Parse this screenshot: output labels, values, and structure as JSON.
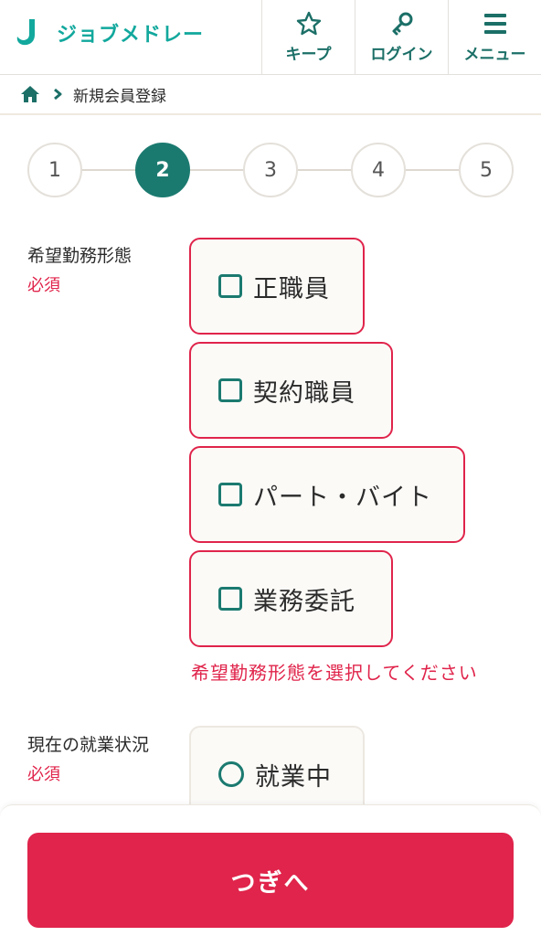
{
  "header": {
    "logo_text": "ジョブメドレー",
    "nav": [
      {
        "label": "キープ",
        "icon": "star-icon"
      },
      {
        "label": "ログイン",
        "icon": "key-icon"
      },
      {
        "label": "メニュー",
        "icon": "hamburger-icon"
      }
    ]
  },
  "breadcrumb": {
    "home_icon": "home-icon",
    "current": "新規会員登録"
  },
  "stepper": {
    "steps": [
      "1",
      "2",
      "3",
      "4",
      "5"
    ],
    "current": 2
  },
  "employment_type": {
    "label": "希望勤務形態",
    "required": "必須",
    "options": [
      "正職員",
      "契約職員",
      "パート・バイト",
      "業務委託"
    ],
    "error": "希望勤務形態を選択してください"
  },
  "work_status": {
    "label": "現在の就業状況",
    "required": "必須",
    "options": [
      "就業中"
    ]
  },
  "next_button": "つぎへ",
  "colors": {
    "brand": "#1b7a70",
    "logo": "#12a89d",
    "error": "#e0244b",
    "primary_button": "#e0244b"
  }
}
